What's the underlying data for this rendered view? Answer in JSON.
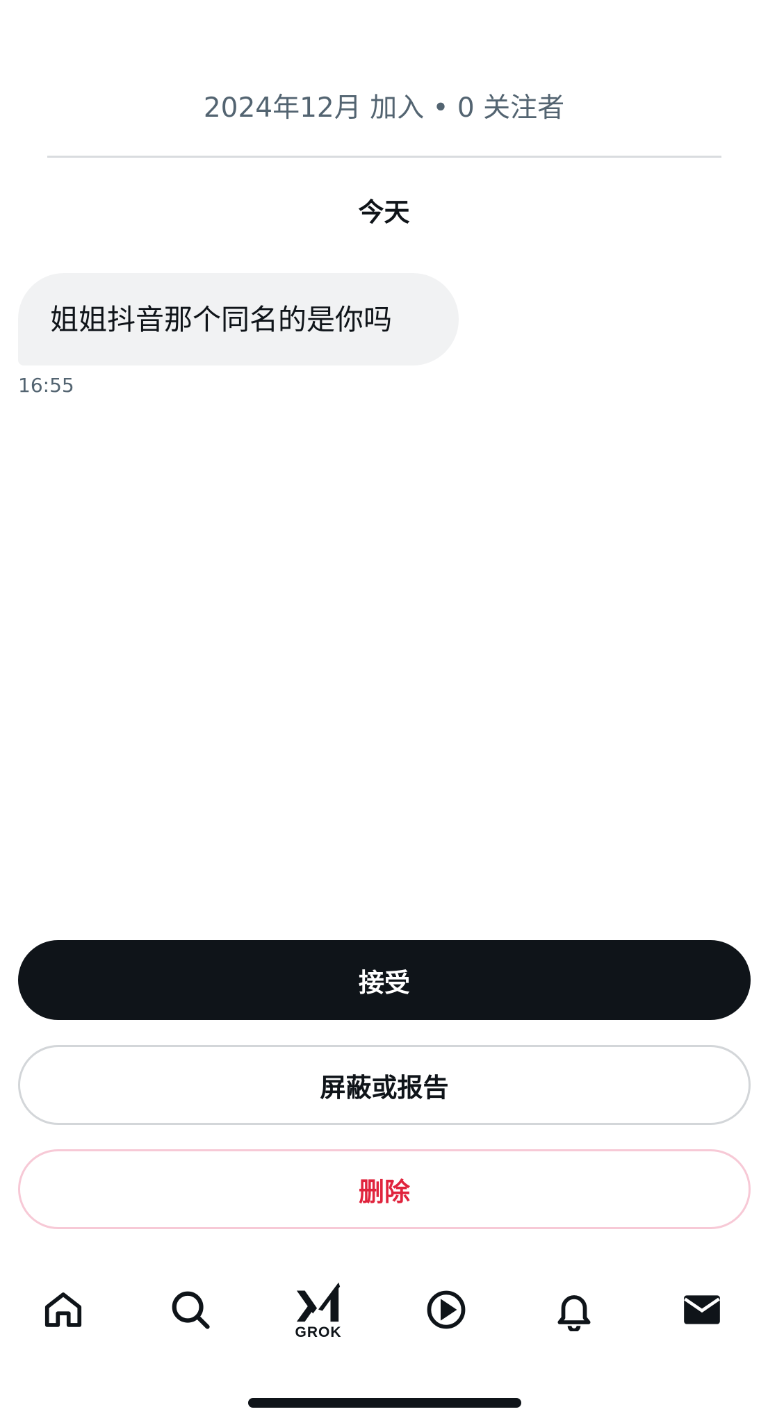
{
  "profile": {
    "join_info": "2024年12月 加入 • 0 关注者"
  },
  "conversation": {
    "date_label": "今天",
    "messages": [
      {
        "text": "姐姐抖音那个同名的是你吗",
        "time": "16:55"
      }
    ]
  },
  "actions": {
    "accept_label": "接受",
    "block_report_label": "屏蔽或报告",
    "delete_label": "删除"
  },
  "nav": {
    "items": [
      {
        "icon": "home-icon"
      },
      {
        "icon": "search-icon"
      },
      {
        "icon": "grok-icon",
        "label": "GROK"
      },
      {
        "icon": "play-icon"
      },
      {
        "icon": "bell-icon"
      },
      {
        "icon": "mail-icon",
        "active": true
      }
    ]
  },
  "colors": {
    "primary_text": "#0f1419",
    "secondary_text": "#536471",
    "bubble_bg": "#f1f2f3",
    "danger": "#e0243d"
  }
}
